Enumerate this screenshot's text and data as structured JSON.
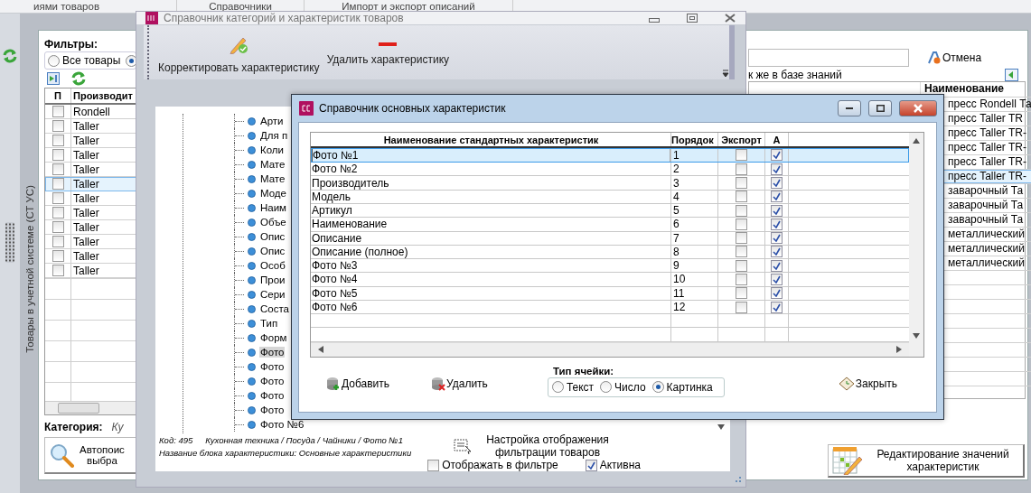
{
  "menu_tabs": [
    {
      "label": "иями товаров"
    },
    {
      "label": "Справочники"
    },
    {
      "label": "Импорт и экспорт описаний"
    }
  ],
  "side_panel": {
    "title": "Товары в учетной системе (СТ УС)"
  },
  "filters": {
    "title": "Фильтры:",
    "options": [
      {
        "label": "Все товары",
        "selected": false
      },
      {
        "selected": true
      }
    ]
  },
  "products_table": {
    "columns": [
      "П",
      "Производит"
    ],
    "rows": [
      {
        "maker": "Rondell",
        "checked": false,
        "selected": false
      },
      {
        "maker": "Taller",
        "checked": false,
        "selected": false
      },
      {
        "maker": "Taller",
        "checked": false,
        "selected": false
      },
      {
        "maker": "Taller",
        "checked": false,
        "selected": false
      },
      {
        "maker": "Taller",
        "checked": false,
        "selected": false
      },
      {
        "maker": "Taller",
        "checked": false,
        "selected": true
      },
      {
        "maker": "Taller",
        "checked": false,
        "selected": false
      },
      {
        "maker": "Taller",
        "checked": false,
        "selected": false
      },
      {
        "maker": "Taller",
        "checked": false,
        "selected": false
      },
      {
        "maker": "Taller",
        "checked": false,
        "selected": false
      },
      {
        "maker": "Taller",
        "checked": false,
        "selected": false
      },
      {
        "maker": "Taller",
        "checked": false,
        "selected": false
      }
    ]
  },
  "category": {
    "label": "Категория:",
    "value": "Ку"
  },
  "autosearch_button": {
    "lines": [
      "Автопоис",
      "выбра"
    ]
  },
  "cancel_button": "Отмена",
  "knowledge_note": "к же в базе знаний",
  "names_table": {
    "column": "Наименование",
    "rows": [
      {
        "name": "пресс Rondell Та",
        "selected": false
      },
      {
        "name": "пресс Taller TR",
        "selected": false
      },
      {
        "name": "пресс Taller TR-",
        "selected": false
      },
      {
        "name": "пресс Taller TR-",
        "selected": false
      },
      {
        "name": "пресс Taller TR-",
        "selected": false
      },
      {
        "name": "пресс Taller TR-",
        "selected": true
      },
      {
        "name": "заварочный Та",
        "selected": false
      },
      {
        "name": "заварочный Та",
        "selected": false
      },
      {
        "name": "заварочный Та",
        "selected": false
      },
      {
        "name": "металлический",
        "selected": false
      },
      {
        "name": "металлический",
        "selected": false
      },
      {
        "name": "металлический",
        "selected": false
      }
    ]
  },
  "edit_values_button": "Редактирование значений характеристик",
  "category_window": {
    "title": "Справочник категорий и характеристик товаров",
    "toolbar": [
      {
        "label": "Корректировать характеристику",
        "kind": "edit"
      },
      {
        "label": "Удалить характеристику",
        "kind": "delete"
      }
    ],
    "tree_items": [
      {
        "label": "Арти",
        "selected": false
      },
      {
        "label": "Для п",
        "selected": false
      },
      {
        "label": "Коли",
        "selected": false
      },
      {
        "label": "Мате",
        "selected": false
      },
      {
        "label": "Мате",
        "selected": false
      },
      {
        "label": "Моде",
        "selected": false
      },
      {
        "label": "Наим",
        "selected": false
      },
      {
        "label": "Объе",
        "selected": false
      },
      {
        "label": "Опис",
        "selected": false
      },
      {
        "label": "Опис",
        "selected": false
      },
      {
        "label": "Особ",
        "selected": false
      },
      {
        "label": "Прои",
        "selected": false
      },
      {
        "label": "Сери",
        "selected": false
      },
      {
        "label": "Соста",
        "selected": false
      },
      {
        "label": "Тип",
        "selected": false
      },
      {
        "label": "Форм",
        "selected": false
      },
      {
        "label": "Фото",
        "selected": true
      },
      {
        "label": "Фото",
        "selected": false
      },
      {
        "label": "Фото",
        "selected": false
      },
      {
        "label": "Фото",
        "selected": false
      },
      {
        "label": "Фото",
        "selected": false
      },
      {
        "label": "Фото №6",
        "selected": false
      }
    ],
    "code": "Код: 495",
    "path": "Кухонная техника / Посуда / Чайники / Фото №1",
    "block_name": "Название блока характеристики: Основные характеристики",
    "show_in_filter": {
      "label": "Отображать в фильтре",
      "checked": false
    },
    "active": {
      "label": "Активна",
      "checked": true
    },
    "filter_settings_button": "Настройка отображения фильтрации товаров"
  },
  "dialog": {
    "title": "Справочник основных характеристик",
    "columns": [
      "Наименование стандартных характеристик",
      "Порядок",
      "Экспорт",
      "А"
    ],
    "rows": [
      {
        "name": "Фото №1",
        "order": "1",
        "export": false,
        "active": true,
        "selected": true
      },
      {
        "name": "Фото №2",
        "order": "2",
        "export": false,
        "active": true,
        "selected": false
      },
      {
        "name": "Производитель",
        "order": "3",
        "export": false,
        "active": true,
        "selected": false
      },
      {
        "name": "Модель",
        "order": "4",
        "export": false,
        "active": true,
        "selected": false
      },
      {
        "name": "Артикул",
        "order": "5",
        "export": false,
        "active": true,
        "selected": false
      },
      {
        "name": "Наименование",
        "order": "6",
        "export": false,
        "active": true,
        "selected": false
      },
      {
        "name": "Описание",
        "order": "7",
        "export": false,
        "active": true,
        "selected": false
      },
      {
        "name": "Описание (полное)",
        "order": "8",
        "export": false,
        "active": true,
        "selected": false
      },
      {
        "name": "Фото №3",
        "order": "9",
        "export": false,
        "active": true,
        "selected": false
      },
      {
        "name": "Фото №4",
        "order": "10",
        "export": false,
        "active": true,
        "selected": false
      },
      {
        "name": "Фото №5",
        "order": "11",
        "export": false,
        "active": true,
        "selected": false
      },
      {
        "name": "Фото №6",
        "order": "12",
        "export": false,
        "active": true,
        "selected": false
      }
    ],
    "add_button": "Добавить",
    "delete_button": "Удалить",
    "cell_type": {
      "title": "Тип ячейки:",
      "options": [
        {
          "label": "Текст",
          "selected": false
        },
        {
          "label": "Число",
          "selected": false
        },
        {
          "label": "Картинка",
          "selected": true
        }
      ]
    },
    "close_button": "Закрыть"
  }
}
